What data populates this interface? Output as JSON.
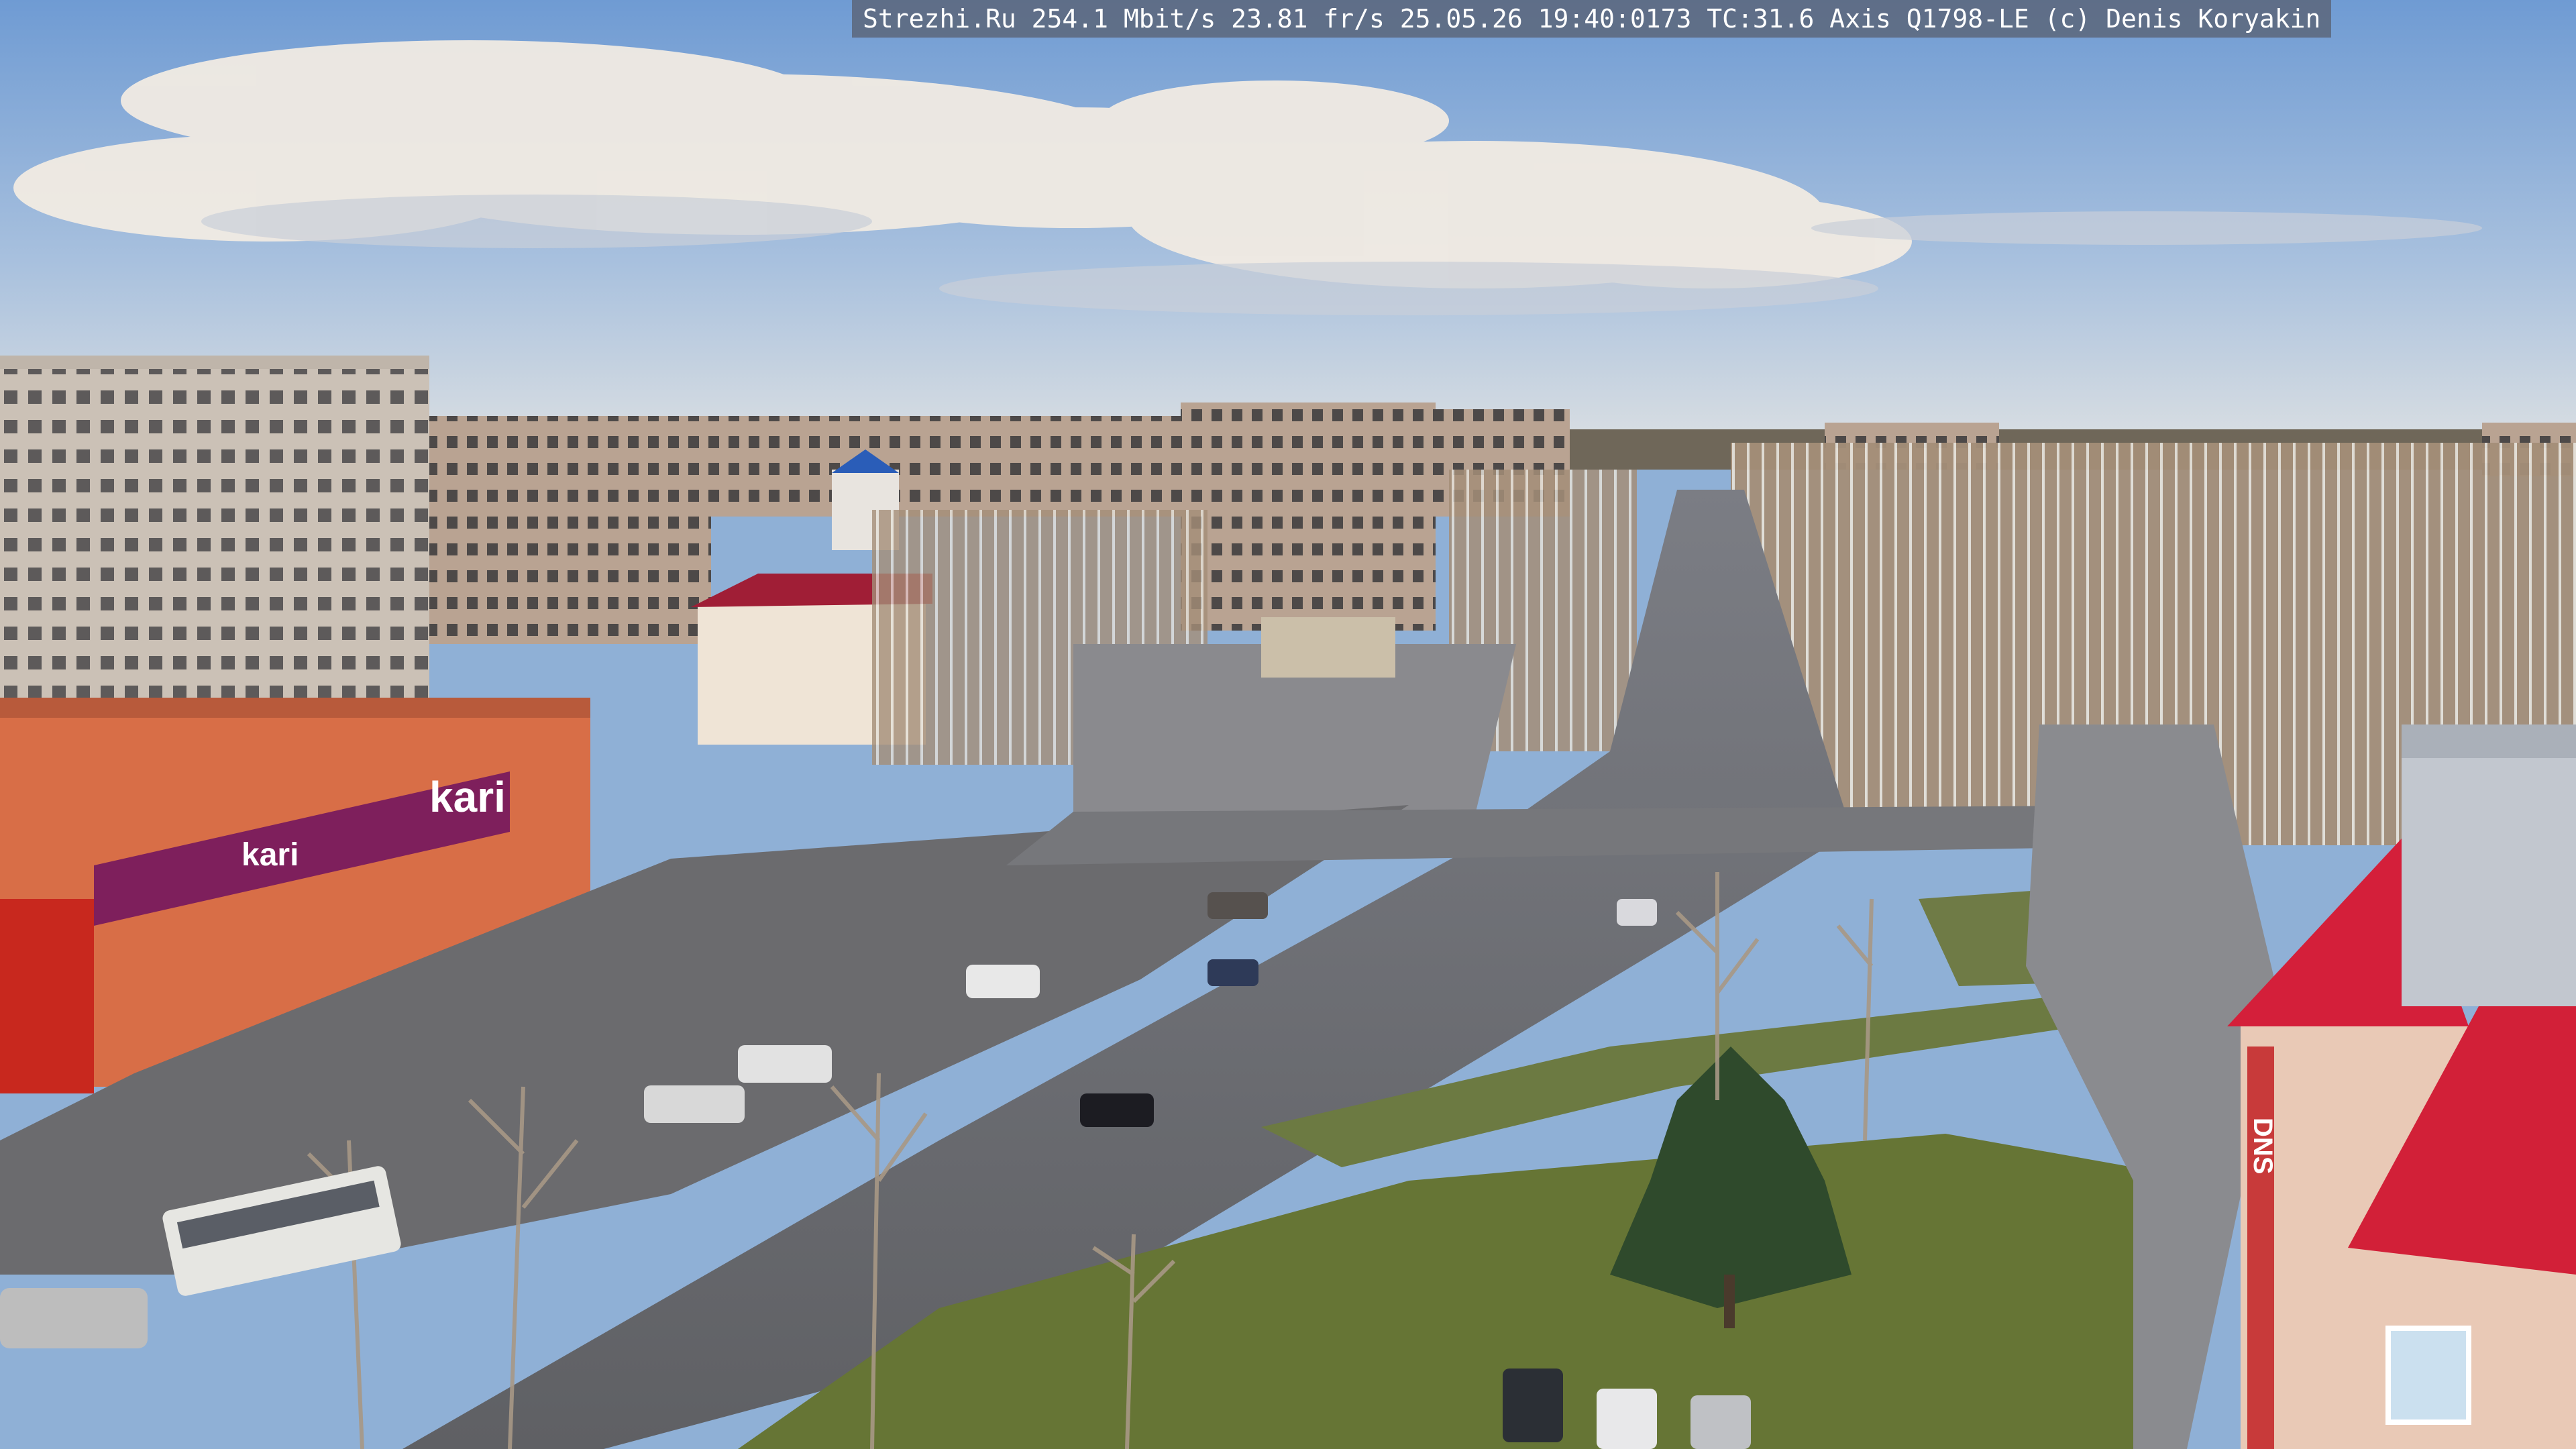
{
  "overlay": {
    "caption": "Strezhi.Ru 254.1 Mbit/s 23.81 fr/s 25.05.26 19:40:0173 TC:31.6  Axis Q1798-LE  (c) Denis Koryakin"
  },
  "signage": {
    "store_logo": "kari",
    "store_sign_2": "kari",
    "dns_sign": "DNS"
  },
  "palette": {
    "sky_top": "#7aa4d8",
    "sky_bottom": "#cfdbe6",
    "cloud": "#f3ede6",
    "building_panel": "#c9bfb4",
    "brick_orange": "#d9704a",
    "roof_red": "#c8283c",
    "asphalt": "#6f6f72",
    "grass": "#6a7a3e",
    "trees_bare": "#9a8672"
  }
}
